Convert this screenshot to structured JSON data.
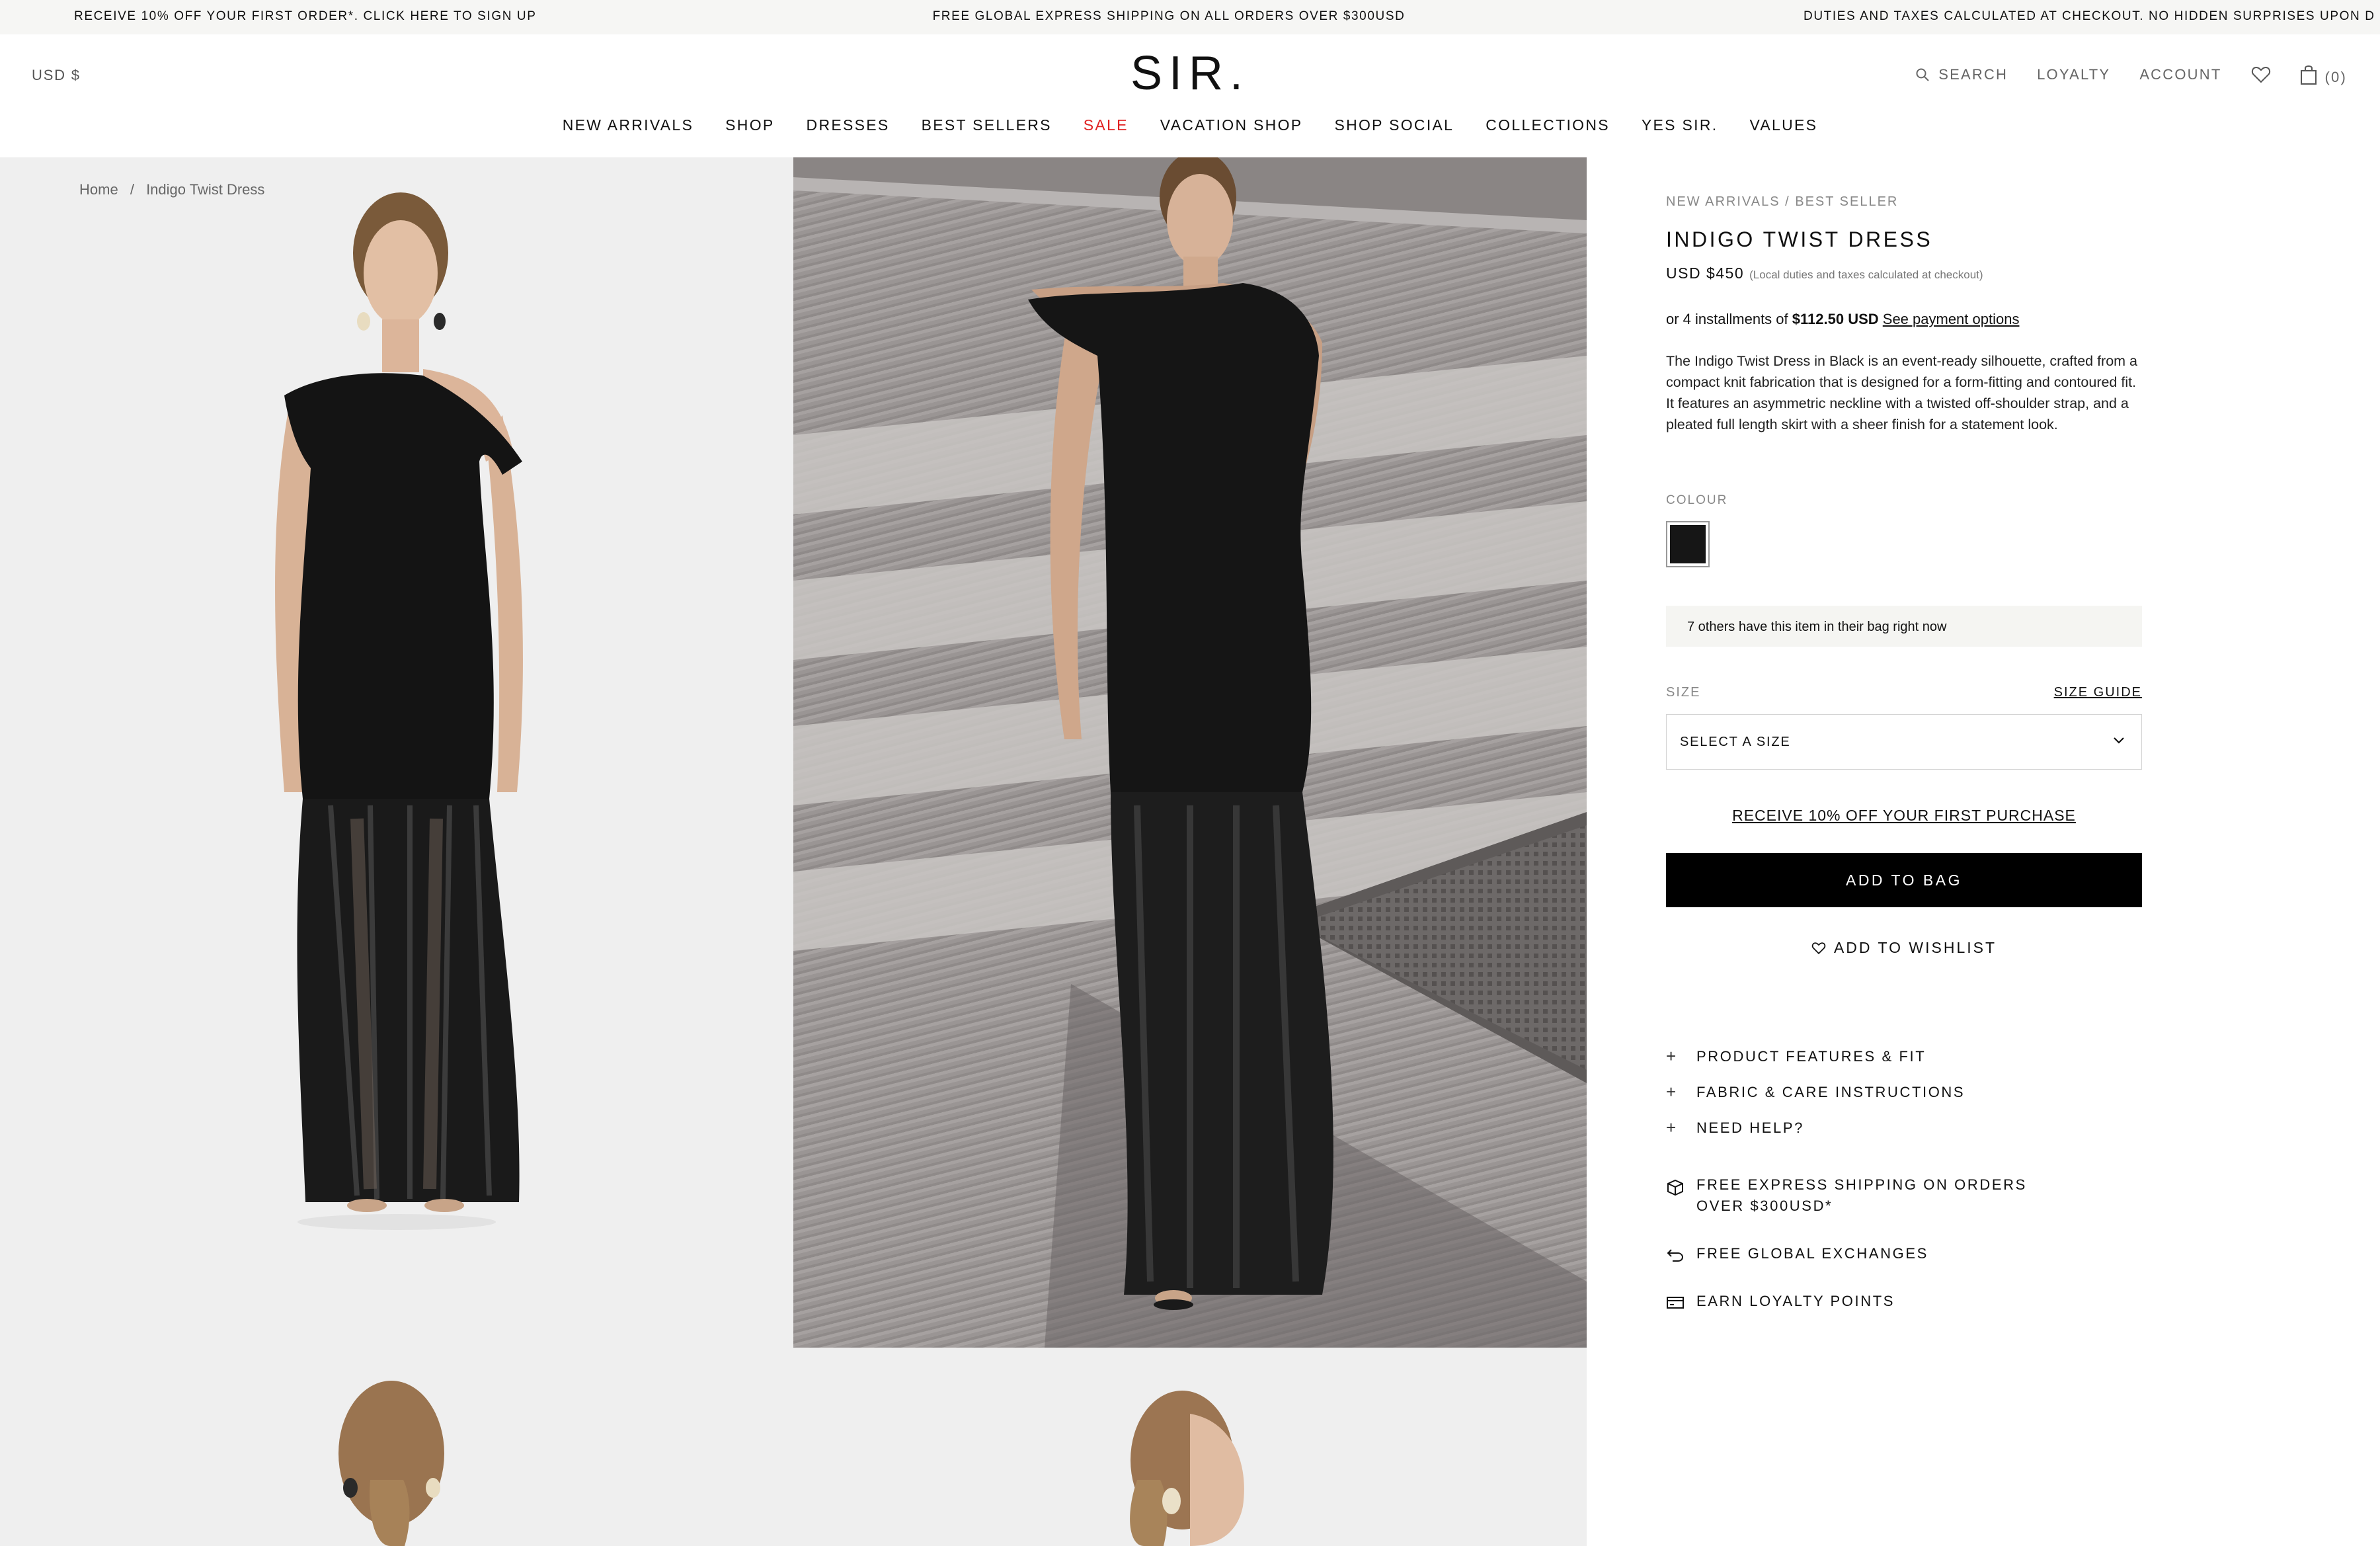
{
  "announcement": {
    "left": "RECEIVE 10% OFF YOUR FIRST ORDER*. CLICK HERE TO SIGN UP",
    "center": "FREE GLOBAL EXPRESS SHIPPING ON ALL ORDERS OVER $300USD",
    "right": "DUTIES AND TAXES CALCULATED AT CHECKOUT. NO HIDDEN SURPRISES UPON D"
  },
  "header": {
    "currency": "USD $",
    "logo": "SIR.",
    "search_label": "SEARCH",
    "loyalty_label": "LOYALTY",
    "account_label": "ACCOUNT",
    "cart_count": "(0)"
  },
  "nav": [
    "NEW ARRIVALS",
    "SHOP",
    "DRESSES",
    "BEST SELLERS",
    "SALE",
    "VACATION SHOP",
    "SHOP SOCIAL",
    "COLLECTIONS",
    "YES SIR.",
    "VALUES"
  ],
  "breadcrumb": {
    "home": "Home",
    "separator": "/",
    "current": "Indigo Twist Dress"
  },
  "product": {
    "category_crumb": "NEW ARRIVALS / BEST SELLER",
    "title": "INDIGO TWIST DRESS",
    "price": "USD $450",
    "price_note": "(Local duties and taxes calculated at checkout)",
    "installment_prefix": "or 4 installments of",
    "installment_amount": "$112.50 USD",
    "installment_link": "See payment options",
    "description": "The Indigo Twist Dress in Black is an event-ready silhouette, crafted from a compact knit fabrication that is designed for a form-fitting and contoured fit. It features an asymmetric neckline with a twisted off-shoulder strap, and a pleated full length skirt with a sheer finish for a statement look.",
    "colour_label": "COLOUR",
    "colour_swatch": "#161616",
    "bag_notice": "7 others have this item in their bag right now",
    "size_label": "SIZE",
    "size_guide": "SIZE GUIDE",
    "size_select": "SELECT A SIZE",
    "promo": "RECEIVE 10% OFF YOUR FIRST PURCHASE",
    "add_to_bag": "ADD TO BAG",
    "add_to_wishlist": "ADD TO WISHLIST",
    "accordion": [
      "PRODUCT FEATURES & FIT",
      "FABRIC & CARE INSTRUCTIONS",
      "NEED HELP?"
    ],
    "features": [
      "FREE EXPRESS SHIPPING ON ORDERS OVER $300USD*",
      "FREE GLOBAL EXCHANGES",
      "EARN LOYALTY POINTS"
    ]
  },
  "icons": {
    "search": "search-icon",
    "wishlist": "heart-icon",
    "cart": "bag-icon",
    "dropdown": "chevron-down-icon",
    "shipping": "box-icon",
    "exchange": "return-icon",
    "loyalty": "card-icon"
  },
  "colors": {
    "sale": "#e02020",
    "primary_button": "#000000",
    "announcement_bg": "#f6f6f4",
    "gallery_bg": "#efefef"
  }
}
